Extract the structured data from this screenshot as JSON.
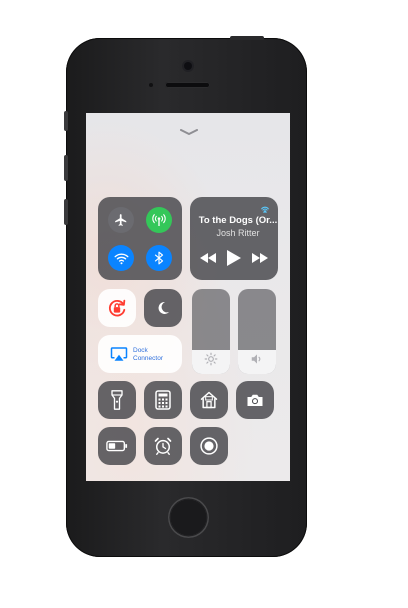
{
  "control_center": {
    "now_playing": {
      "title": "To the Dogs (Or...",
      "artist": "Josh Ritter"
    },
    "screen_mirroring": {
      "label_line1": "Dock",
      "label_line2": "Connector"
    },
    "colors": {
      "cellular_active": "#34c759",
      "wifi_active": "#0a84ff",
      "bluetooth_active": "#0a84ff",
      "rotation_lock": "#ff3b30",
      "tile_dark": "#46464b",
      "tile_light": "#ffffff"
    },
    "brightness_level": 0.28,
    "volume_level": 0.28,
    "icons": [
      "chevron-down-icon",
      "airplane-icon",
      "cellular-icon",
      "wifi-icon",
      "bluetooth-icon",
      "airplay-audio-icon",
      "rewind-icon",
      "play-icon",
      "fast-forward-icon",
      "rotation-lock-icon",
      "moon-icon",
      "sun-icon",
      "speaker-icon",
      "airplay-icon",
      "flashlight-icon",
      "calculator-icon",
      "home-icon",
      "camera-icon",
      "battery-icon",
      "alarm-clock-icon",
      "screen-record-icon"
    ]
  }
}
